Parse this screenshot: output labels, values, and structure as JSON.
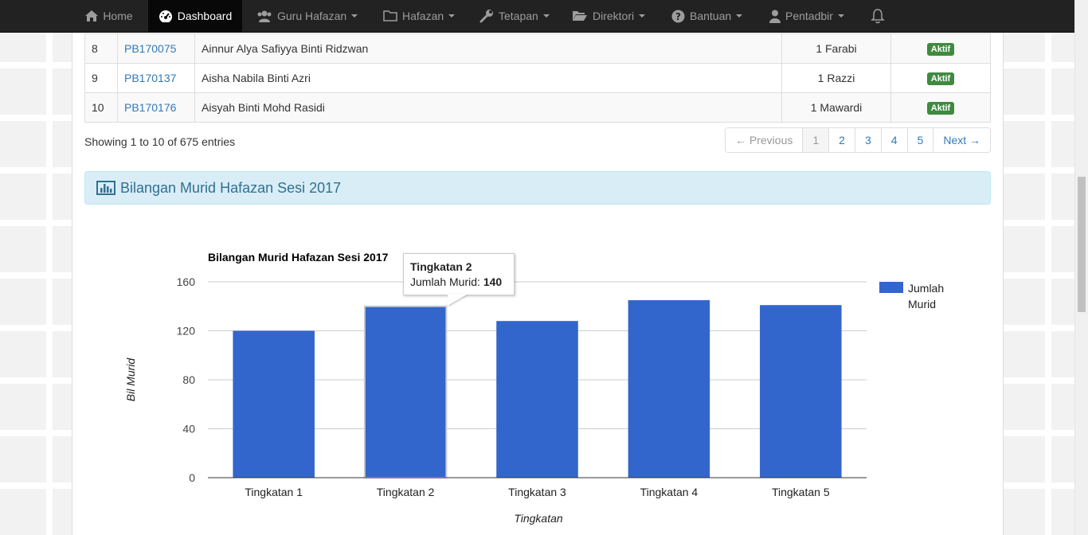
{
  "navbar": {
    "items": [
      {
        "label": "Home",
        "icon": "home-icon"
      },
      {
        "label": "Dashboard",
        "icon": "dashboard-icon"
      },
      {
        "label": "Guru Hafazan",
        "icon": "users-icon"
      },
      {
        "label": "Hafazan",
        "icon": "folder-icon"
      },
      {
        "label": "Tetapan",
        "icon": "wrench-icon"
      },
      {
        "label": "Direktori",
        "icon": "folder-open-icon"
      },
      {
        "label": "Bantuan",
        "icon": "question-circle-icon"
      },
      {
        "label": "Pentadbir",
        "icon": "user-icon"
      }
    ],
    "active": "Dashboard",
    "bell_icon": "bell-icon"
  },
  "table": {
    "rows": [
      {
        "no": "8",
        "id": "PB170075",
        "name": "Ainnur Alya Safiyya Binti Ridzwan",
        "kelas": "1 Farabi",
        "status": "Aktif"
      },
      {
        "no": "9",
        "id": "PB170137",
        "name": "Aisha Nabila Binti Azri",
        "kelas": "1 Razzi",
        "status": "Aktif"
      },
      {
        "no": "10",
        "id": "PB170176",
        "name": "Aisyah Binti Mohd Rasidi",
        "kelas": "1 Mawardi",
        "status": "Aktif"
      }
    ],
    "info": "Showing 1 to 10 of 675 entries",
    "pagination": {
      "previous": "← Previous",
      "pages": [
        "1",
        "2",
        "3",
        "4",
        "5"
      ],
      "current": "1",
      "next": "Next →"
    }
  },
  "panel": {
    "title": "Bilangan Murid Hafazan Sesi 2017",
    "icon": "bar-chart-icon"
  },
  "chart_data": {
    "type": "bar",
    "title": "Bilangan Murid Hafazan Sesi 2017",
    "categories": [
      "Tingkatan 1",
      "Tingkatan 2",
      "Tingkatan 3",
      "Tingkatan 4",
      "Tingkatan 5"
    ],
    "series": [
      {
        "name": "Jumlah Murid",
        "values": [
          120,
          140,
          128,
          145,
          141
        ]
      }
    ],
    "xlabel": "Tingkatan",
    "ylabel": "Bil Murid",
    "ylim": [
      0,
      160
    ],
    "yticks": [
      "0",
      "40",
      "80",
      "120",
      "160"
    ],
    "grid": true,
    "legend_position": "right",
    "bar_color": "#3366cc",
    "tooltip": {
      "category": "Tingkatan 2",
      "label": "Jumlah Murid:",
      "value": "140"
    }
  }
}
